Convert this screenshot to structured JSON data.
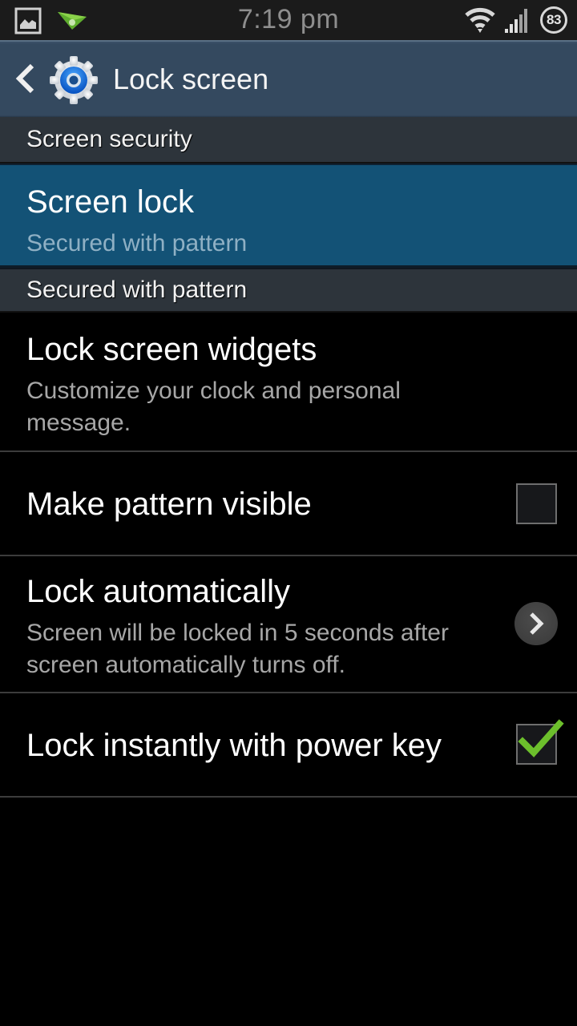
{
  "status_bar": {
    "time": "7:19 pm",
    "battery_level": "83",
    "icons": [
      "gallery-icon",
      "airdroid-icon",
      "wifi-icon",
      "signal-icon",
      "battery-icon"
    ]
  },
  "action_bar": {
    "title": "Lock screen",
    "back_icon": "back-chevron-icon",
    "app_icon": "settings-gear-icon"
  },
  "categories": [
    {
      "label": "Screen security"
    },
    {
      "label": "Secured with pattern"
    }
  ],
  "preferences": [
    {
      "title": "Screen lock",
      "summary": "Secured with pattern",
      "highlighted": true
    },
    {
      "title": "Lock screen widgets",
      "summary": "Customize your clock and personal message."
    },
    {
      "title": "Make pattern visible",
      "checked": false
    },
    {
      "title": "Lock automatically",
      "summary": "Screen will be locked in 5 seconds after screen automatically turns off.",
      "widget": "chevron-right-icon"
    },
    {
      "title": "Lock instantly with power key",
      "checked": true
    }
  ],
  "colors": {
    "action_bar": "#34495f",
    "highlight": "#135276",
    "category_bg": "#2d343b",
    "check_green": "#6cbf2c"
  }
}
